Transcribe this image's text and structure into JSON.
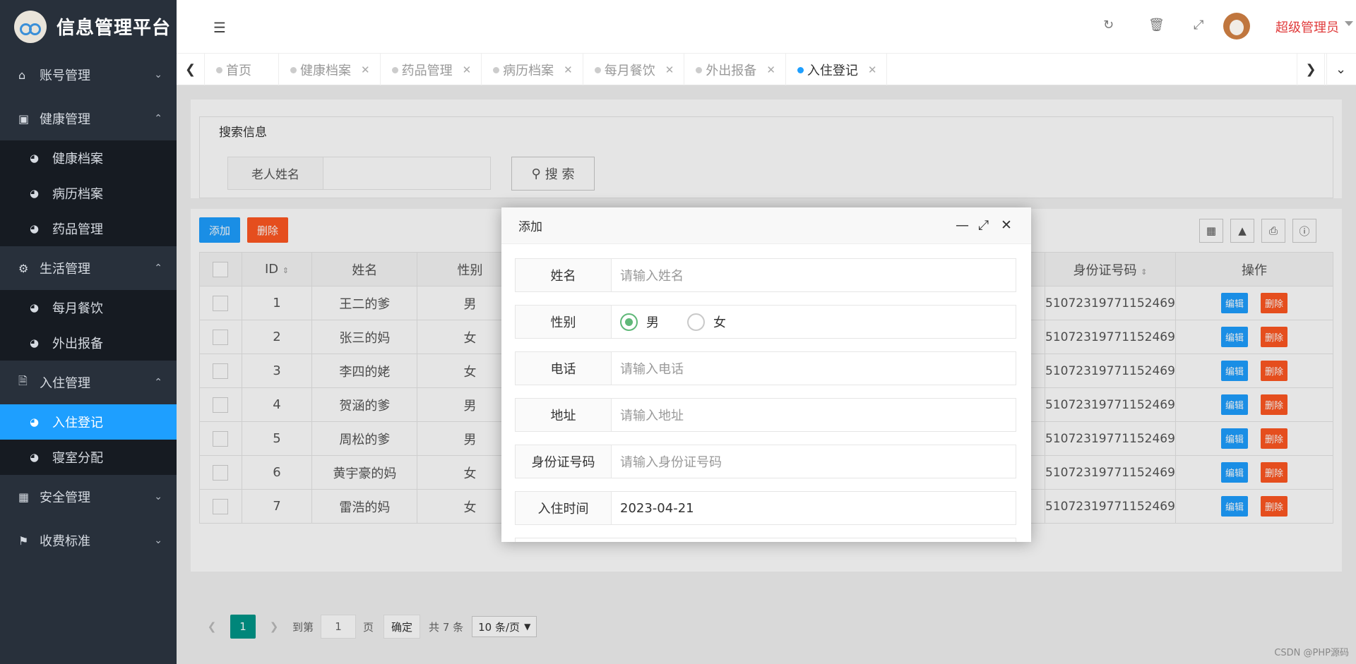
{
  "app": {
    "title": "信息管理平台"
  },
  "sidebar": {
    "groups": [
      {
        "label": "账号管理",
        "icon": "home-icon",
        "items": []
      },
      {
        "label": "健康管理",
        "icon": "window-icon",
        "items": [
          "健康档案",
          "病历档案",
          "药品管理"
        ]
      },
      {
        "label": "生活管理",
        "icon": "gears-icon",
        "items": [
          "每月餐饮",
          "外出报备"
        ]
      },
      {
        "label": "入住管理",
        "icon": "file-icon",
        "items": [
          "入住登记",
          "寝室分配"
        ]
      },
      {
        "label": "安全管理",
        "icon": "calendar-icon",
        "items": []
      },
      {
        "label": "收费标准",
        "icon": "flag-icon",
        "items": []
      }
    ],
    "active_item": "入住登记"
  },
  "header": {
    "admin_name": "超级管理员"
  },
  "tabs": {
    "items": [
      "首页",
      "健康档案",
      "药品管理",
      "病历档案",
      "每月餐饮",
      "外出报备",
      "入住登记"
    ],
    "active": "入住登记"
  },
  "search": {
    "legend": "搜索信息",
    "label": "老人姓名",
    "button": "搜 索"
  },
  "toolbar": {
    "add": "添加",
    "delete": "删除"
  },
  "table": {
    "headers": [
      "ID",
      "姓名",
      "性别",
      "身份证号码",
      "操作"
    ],
    "rows": [
      {
        "id": "1",
        "name": "王二的爹",
        "gender": "男",
        "idcard": "51072319771152469"
      },
      {
        "id": "2",
        "name": "张三的妈",
        "gender": "女",
        "idcard": "51072319771152469"
      },
      {
        "id": "3",
        "name": "李四的姥",
        "gender": "女",
        "idcard": "51072319771152469"
      },
      {
        "id": "4",
        "name": "贺涵的爹",
        "gender": "男",
        "idcard": "51072319771152469"
      },
      {
        "id": "5",
        "name": "周松的爹",
        "gender": "男",
        "idcard": "51072319771152469"
      },
      {
        "id": "6",
        "name": "黄宇豪的妈",
        "gender": "女",
        "idcard": "51072319771152469"
      },
      {
        "id": "7",
        "name": "雷浩的妈",
        "gender": "女",
        "idcard": "51072319771152469"
      }
    ],
    "edit_label": "编辑",
    "delete_label": "删除"
  },
  "pager": {
    "current": "1",
    "goto_label": "到第",
    "page_input": "1",
    "page_unit": "页",
    "confirm": "确定",
    "total": "共 7 条",
    "page_size": "10 条/页"
  },
  "modal": {
    "title": "添加",
    "fields": {
      "name_label": "姓名",
      "name_placeholder": "请输入姓名",
      "gender_label": "性别",
      "gender_male": "男",
      "gender_female": "女",
      "phone_label": "电话",
      "phone_placeholder": "请输入电话",
      "address_label": "地址",
      "address_placeholder": "请输入地址",
      "idcard_label": "身份证号码",
      "idcard_placeholder": "请输入身份证号码",
      "checkin_label": "入住时间",
      "checkin_value": "2023-04-21"
    }
  },
  "watermark": "CSDN @PHP源码"
}
